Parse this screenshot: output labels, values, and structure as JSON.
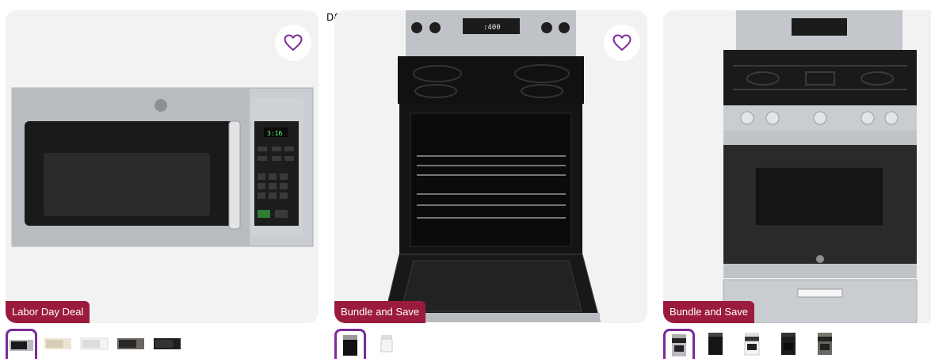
{
  "brand_label": "D&C",
  "colors": {
    "badge_bg": "#9b1b3d",
    "accent_purple": "#7b2a9a",
    "card_bg": "#f2f2f2"
  },
  "products": [
    {
      "badge": "Labor Day Deal",
      "favorite_icon": "heart-outline-icon",
      "image": "over-the-range-microwave",
      "swatches": [
        {
          "name": "stainless",
          "selected": true
        },
        {
          "name": "bisque",
          "selected": false
        },
        {
          "name": "white",
          "selected": false
        },
        {
          "name": "slate",
          "selected": false
        },
        {
          "name": "black",
          "selected": false
        }
      ]
    },
    {
      "badge": "Bundle and Save",
      "favorite_icon": "heart-outline-icon",
      "image": "electric-range-door-open",
      "swatches": [
        {
          "name": "black",
          "selected": true
        },
        {
          "name": "white",
          "selected": false
        }
      ]
    },
    {
      "badge": "Bundle and Save",
      "image": "gas-range",
      "swatches": [
        {
          "name": "stainless",
          "selected": true
        },
        {
          "name": "black",
          "selected": false
        },
        {
          "name": "white",
          "selected": false
        },
        {
          "name": "black-slate",
          "selected": false
        },
        {
          "name": "slate",
          "selected": false
        }
      ]
    }
  ]
}
